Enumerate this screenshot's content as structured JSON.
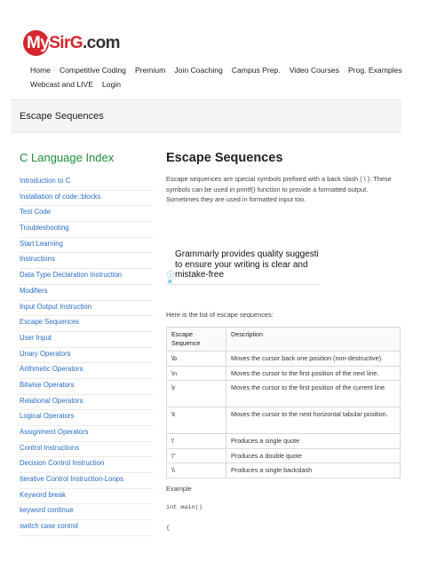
{
  "logo": {
    "my": "My",
    "sirg": "SirG",
    "com": ".com"
  },
  "nav": {
    "row1": [
      "Home",
      "Competitive Coding",
      "Premium",
      "Join Coaching",
      "Campus Prep.",
      "Video Courses",
      "Prog. Examples"
    ],
    "row2": [
      "Webcast and LIVE",
      "Login"
    ]
  },
  "page_title": "Escape Sequences",
  "sidebar": {
    "heading": "C Language Index",
    "items": [
      "Introduction to C",
      "Installation of code::blocks",
      "Test Code",
      "Troubleshooting",
      "Start Learning",
      "Instructions",
      "Data Type Declaration Instruction",
      "Modifiers",
      "Input Output Instruction",
      "Escape Sequences",
      "User Input",
      "Unary Operators",
      "Arithmetic Operators",
      "Bitwise Operators",
      "Relational Operators",
      "Logical Operators",
      "Assignment Operators",
      "Control Instructions",
      "Decision Control Instruction",
      "Iterative Control Instruction-Loops",
      "Keyword break",
      "keyword continue",
      "switch case control"
    ]
  },
  "main": {
    "title": "Escape Sequences",
    "description": "Escape sequences are special symbols prefixed with a back slash ( \\ ). These symbols can be used in printf() function to provide a formatted output. Sometimes they are used in formatted input too.",
    "ad": {
      "line1": "Grammarly provides quality suggesti",
      "line2": "to ensure your writing is clear and",
      "line3": "mistake-free"
    },
    "list_intro": "Here is the list of escape sequences:",
    "table": {
      "headers": [
        "Escape Sequence",
        "Description"
      ],
      "rows": [
        {
          "seq": "\\b",
          "desc": "Moves the cursor back one position (non-destructive)."
        },
        {
          "seq": "\\n",
          "desc": "Moves the cursor to the first position of the next line."
        },
        {
          "seq": "\\r",
          "desc": "Moves the cursor to the first position of the current line"
        },
        {
          "seq": "\\t",
          "desc": "Moves the cursor to the next horizontal tabular position."
        },
        {
          "seq": "\\'",
          "desc": "Produces a single quote"
        },
        {
          "seq": "\\\"",
          "desc": "Produces a double quote"
        },
        {
          "seq": "\\\\",
          "desc": "Produces a single backslash"
        }
      ]
    },
    "example_label": "Example",
    "code": [
      "int main()",
      "{"
    ]
  },
  "colors": {
    "brand_red": "#d7262e",
    "link_blue": "#2a6cc7",
    "heading_green": "#1e8c3a"
  },
  "icons": {
    "ad_info": "info-icon",
    "ad_close": "close-icon"
  }
}
